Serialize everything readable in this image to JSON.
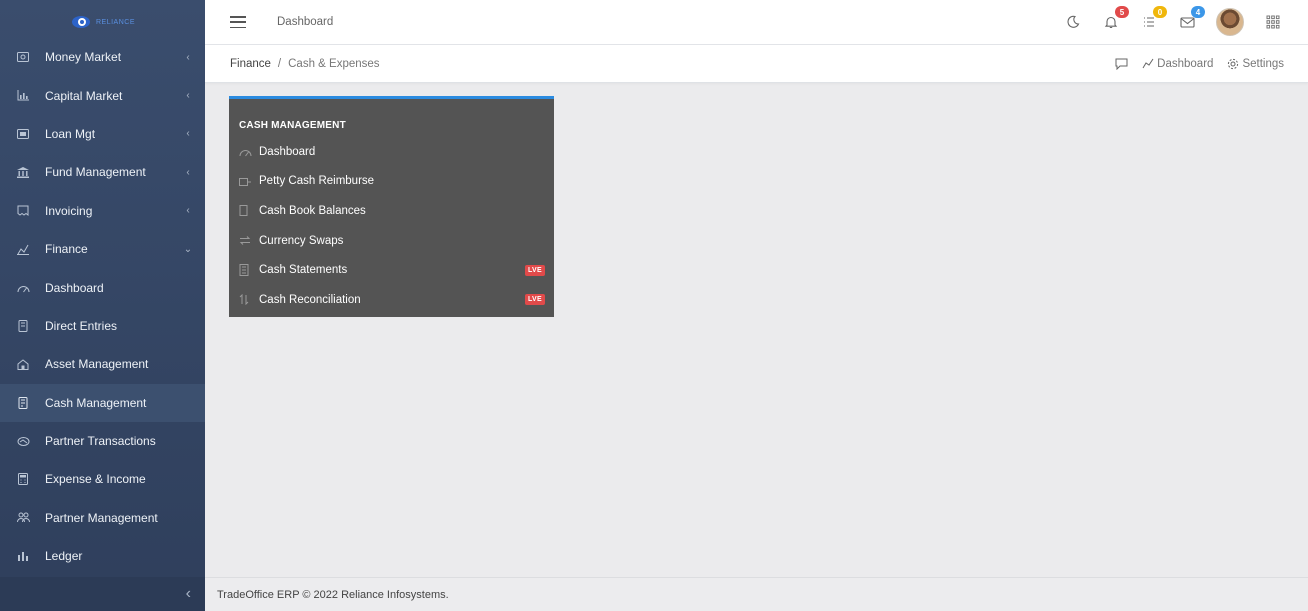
{
  "logo": {
    "text": "RELIANCE"
  },
  "sidebar": {
    "items": [
      {
        "label": "Money Market",
        "icon": "money-icon",
        "chevron": "‹"
      },
      {
        "label": "Capital Market",
        "icon": "bar-chart-icon",
        "chevron": "‹"
      },
      {
        "label": "Loan Mgt",
        "icon": "loan-icon",
        "chevron": "‹"
      },
      {
        "label": "Fund Management",
        "icon": "bank-icon",
        "chevron": "‹"
      },
      {
        "label": "Invoicing",
        "icon": "invoice-icon",
        "chevron": "‹"
      },
      {
        "label": "Finance",
        "icon": "finance-icon",
        "chevron": "⌄"
      },
      {
        "label": "Dashboard",
        "icon": "gauge-icon"
      },
      {
        "label": "Direct Entries",
        "icon": "book-icon"
      },
      {
        "label": "Asset Management",
        "icon": "house-icon"
      },
      {
        "label": "Cash Management",
        "icon": "cash-icon"
      },
      {
        "label": "Partner Transactions",
        "icon": "handshake-icon"
      },
      {
        "label": "Expense & Income",
        "icon": "calculator-icon"
      },
      {
        "label": "Partner Management",
        "icon": "people-icon"
      },
      {
        "label": "Ledger",
        "icon": "ledger-icon"
      }
    ],
    "collapse_glyph": "‹"
  },
  "header": {
    "title": "Dashboard",
    "notifications_count": "5",
    "tasks_count": "0",
    "messages_count": "4"
  },
  "breadcrumb": {
    "root": "Finance",
    "separator": "/",
    "current": "Cash & Expenses",
    "dashboard_link": "Dashboard",
    "settings_link": "Settings"
  },
  "panel": {
    "heading": "CASH MANAGEMENT",
    "items": [
      {
        "label": "Dashboard",
        "icon": "gauge-icon",
        "badge": ""
      },
      {
        "label": "Petty Cash Reimburse",
        "icon": "wallet-icon",
        "badge": ""
      },
      {
        "label": "Cash Book Balances",
        "icon": "book-icon",
        "badge": ""
      },
      {
        "label": "Currency Swaps",
        "icon": "swap-icon",
        "badge": ""
      },
      {
        "label": "Cash Statements",
        "icon": "document-icon",
        "badge": "LVE"
      },
      {
        "label": "Cash Reconciliation",
        "icon": "sort-icon",
        "badge": "LVE"
      }
    ]
  },
  "footer": {
    "text": "TradeOffice ERP © 2022 Reliance Infosystems."
  },
  "colors": {
    "sidebar": "#354765",
    "accent": "#2b8be0",
    "panel": "#545454",
    "live": "#e14a4a"
  }
}
